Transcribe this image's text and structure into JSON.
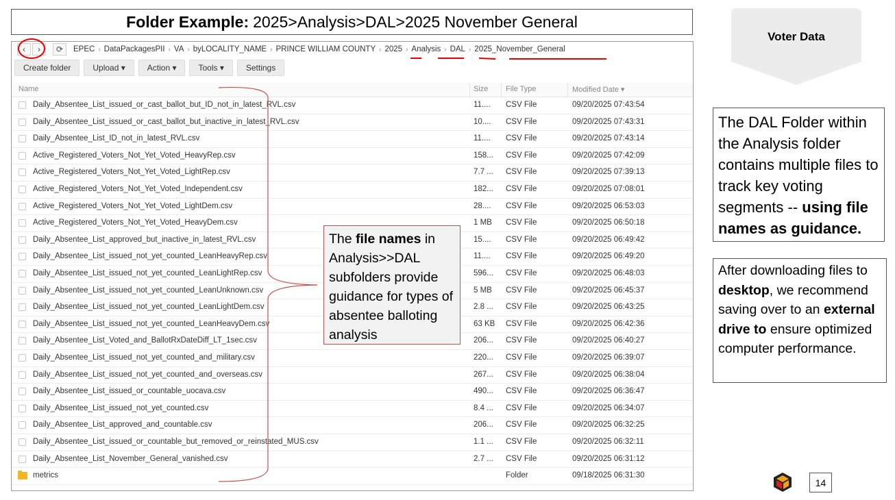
{
  "title": {
    "bold": "Folder Example:",
    "rest": "2025>Analysis>DAL>2025 November General"
  },
  "nav": {
    "back_icon": "chevron-left-icon",
    "forward_icon": "chevron-right-icon",
    "refresh_icon": "refresh-icon"
  },
  "breadcrumb": [
    "EPEC",
    "DataPackagesPII",
    "VA",
    "byLOCALITY_NAME",
    "PRINCE WILLIAM COUNTY",
    "2025",
    "Analysis",
    "DAL",
    "2025_November_General"
  ],
  "toolbar": {
    "create_folder": "Create folder",
    "upload": "Upload ▾",
    "action": "Action ▾",
    "tools": "Tools ▾",
    "settings": "Settings"
  },
  "columns": {
    "name": "Name",
    "size": "Size",
    "type": "File Type",
    "modified": "Modified Date ▾"
  },
  "files": [
    {
      "name": "Daily_Absentee_List_issued_or_cast_ballot_but_ID_not_in_latest_RVL.csv",
      "size": "11....",
      "type": "CSV File",
      "modified": "09/20/2025 07:43:54"
    },
    {
      "name": "Daily_Absentee_List_issued_or_cast_ballot_but_inactive_in_latest_RVL.csv",
      "size": "10....",
      "type": "CSV File",
      "modified": "09/20/2025 07:43:31"
    },
    {
      "name": "Daily_Absentee_List_ID_not_in_latest_RVL.csv",
      "size": "11....",
      "type": "CSV File",
      "modified": "09/20/2025 07:43:14"
    },
    {
      "name": "Active_Registered_Voters_Not_Yet_Voted_HeavyRep.csv",
      "size": "158...",
      "type": "CSV File",
      "modified": "09/20/2025 07:42:09"
    },
    {
      "name": "Active_Registered_Voters_Not_Yet_Voted_LightRep.csv",
      "size": "7.7 ...",
      "type": "CSV File",
      "modified": "09/20/2025 07:39:13"
    },
    {
      "name": "Active_Registered_Voters_Not_Yet_Voted_Independent.csv",
      "size": "182...",
      "type": "CSV File",
      "modified": "09/20/2025 07:08:01"
    },
    {
      "name": "Active_Registered_Voters_Not_Yet_Voted_LightDem.csv",
      "size": "28....",
      "type": "CSV File",
      "modified": "09/20/2025 06:53:03"
    },
    {
      "name": "Active_Registered_Voters_Not_Yet_Voted_HeavyDem.csv",
      "size": "1 MB",
      "type": "CSV File",
      "modified": "09/20/2025 06:50:18"
    },
    {
      "name": "Daily_Absentee_List_approved_but_inactive_in_latest_RVL.csv",
      "size": "15....",
      "type": "CSV File",
      "modified": "09/20/2025 06:49:42"
    },
    {
      "name": "Daily_Absentee_List_issued_not_yet_counted_LeanHeavyRep.csv",
      "size": "11....",
      "type": "CSV File",
      "modified": "09/20/2025 06:49:20"
    },
    {
      "name": "Daily_Absentee_List_issued_not_yet_counted_LeanLightRep.csv",
      "size": "596...",
      "type": "CSV File",
      "modified": "09/20/2025 06:48:03"
    },
    {
      "name": "Daily_Absentee_List_issued_not_yet_counted_LeanUnknown.csv",
      "size": "5 MB",
      "type": "CSV File",
      "modified": "09/20/2025 06:45:37"
    },
    {
      "name": "Daily_Absentee_List_issued_not_yet_counted_LeanLightDem.csv",
      "size": "2.8 ...",
      "type": "CSV File",
      "modified": "09/20/2025 06:43:25"
    },
    {
      "name": "Daily_Absentee_List_issued_not_yet_counted_LeanHeavyDem.csv",
      "size": "63 KB",
      "type": "CSV File",
      "modified": "09/20/2025 06:42:36"
    },
    {
      "name": "Daily_Absentee_List_Voted_and_BallotRxDateDiff_LT_1sec.csv",
      "size": "206...",
      "type": "CSV File",
      "modified": "09/20/2025 06:40:27"
    },
    {
      "name": "Daily_Absentee_List_issued_not_yet_counted_and_military.csv",
      "size": "220...",
      "type": "CSV File",
      "modified": "09/20/2025 06:39:07"
    },
    {
      "name": "Daily_Absentee_List_issued_not_yet_counted_and_overseas.csv",
      "size": "267...",
      "type": "CSV File",
      "modified": "09/20/2025 06:38:04"
    },
    {
      "name": "Daily_Absentee_List_issued_or_countable_uocava.csv",
      "size": "490...",
      "type": "CSV File",
      "modified": "09/20/2025 06:36:47"
    },
    {
      "name": "Daily_Absentee_List_issued_not_yet_counted.csv",
      "size": "8.4 ...",
      "type": "CSV File",
      "modified": "09/20/2025 06:34:07"
    },
    {
      "name": "Daily_Absentee_List_approved_and_countable.csv",
      "size": "206...",
      "type": "CSV File",
      "modified": "09/20/2025 06:32:25"
    },
    {
      "name": "Daily_Absentee_List_issued_or_countable_but_removed_or_reinstated_MUS.csv",
      "size": "1.1 ...",
      "type": "CSV File",
      "modified": "09/20/2025 06:32:11"
    },
    {
      "name": "Daily_Absentee_List_November_General_vanished.csv",
      "size": "2.7 ...",
      "type": "CSV File",
      "modified": "09/20/2025 06:31:12"
    },
    {
      "name": "metrics",
      "size": "",
      "type": "Folder",
      "modified": "09/18/2025 06:31:30",
      "is_folder": true
    }
  ],
  "callout": {
    "p1": "The ",
    "b1": "file names",
    "p2": " in Analysis>>DAL subfolders provide guidance for types of absentee balloting analysis"
  },
  "voter_label": "Voter Data",
  "note1": {
    "p1": "The DAL Folder within the Analysis folder contains multiple files to track key voting segments -- ",
    "b1": "using file names as guidance."
  },
  "note2": {
    "p1": "After downloading files to ",
    "b1": "desktop",
    "p2": ", we recommend saving over to an ",
    "b2": "external drive to",
    "p3": " ensure optimized computer performance."
  },
  "page_number": "14",
  "colors": {
    "annotation_red": "#e00000",
    "callout_border": "#c0504d",
    "folder_yellow": "#f3b623"
  }
}
